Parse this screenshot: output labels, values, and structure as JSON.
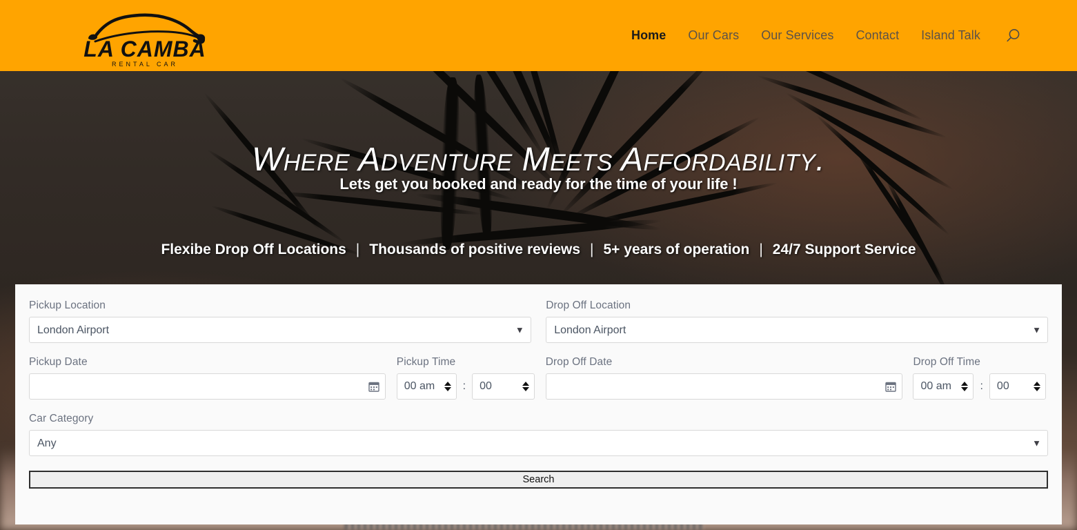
{
  "brand": {
    "name": "LA CAMBA",
    "tagline": "RENTAL CAR",
    "logo_icon": "car-outline-logo",
    "header_color": "#ffa400"
  },
  "nav": {
    "items": [
      {
        "label": "Home",
        "active": true
      },
      {
        "label": "Our Cars",
        "active": false
      },
      {
        "label": "Our Services",
        "active": false
      },
      {
        "label": "Contact",
        "active": false
      },
      {
        "label": "Island Talk",
        "active": false
      }
    ],
    "search_icon": "search-icon"
  },
  "hero": {
    "title": "Where Adventure Meets Affordability.",
    "subtitle": "Lets get you booked and ready for the time of your life !",
    "features": [
      "Flexibe Drop Off Locations",
      "Thousands of positive reviews",
      "5+ years of operation",
      "24/7 Support Service"
    ],
    "separator": "|"
  },
  "booking_form": {
    "pickup_location": {
      "label": "Pickup Location",
      "value": "London Airport",
      "options": [
        "London Airport"
      ]
    },
    "dropoff_location": {
      "label": "Drop Off Location",
      "value": "London Airport",
      "options": [
        "London Airport"
      ]
    },
    "pickup_date": {
      "label": "Pickup Date",
      "value": "",
      "placeholder": "",
      "icon": "calendar-icon"
    },
    "pickup_time": {
      "label": "Pickup Time",
      "hour": "00 am",
      "minute": "00",
      "separator": ":"
    },
    "dropoff_date": {
      "label": "Drop Off Date",
      "value": "",
      "placeholder": "",
      "icon": "calendar-icon"
    },
    "dropoff_time": {
      "label": "Drop Off Time",
      "hour": "00 am",
      "minute": "00",
      "separator": ":"
    },
    "car_category": {
      "label": "Car Category",
      "value": "Any",
      "options": [
        "Any"
      ]
    },
    "search_button": "Search"
  }
}
